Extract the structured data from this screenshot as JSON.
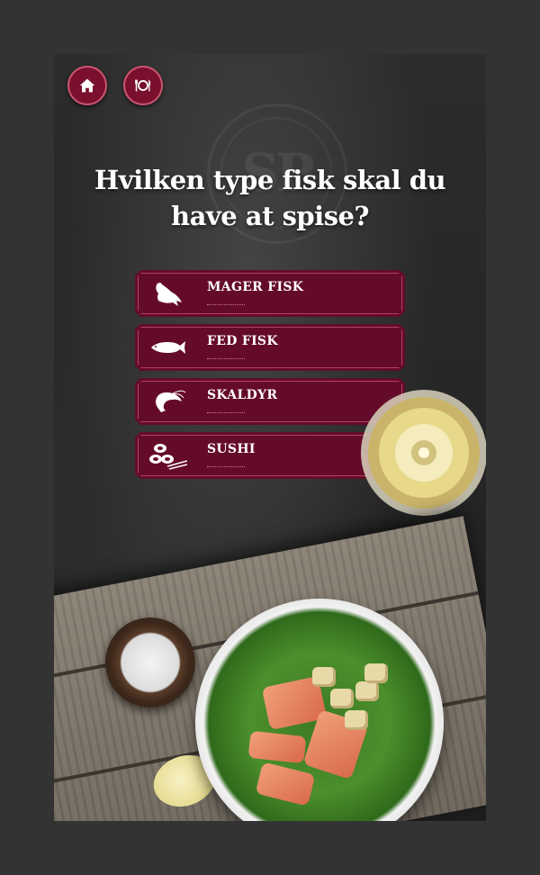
{
  "nav": {
    "home_icon": "home-icon",
    "menu_icon": "plate-cutlery-icon"
  },
  "question": {
    "line1": "Hvilken type fisk skal du",
    "line2": "have at spise?"
  },
  "options": [
    {
      "label": "MAGER FISK",
      "icon": "lean-fish-icon"
    },
    {
      "label": "FED FISK",
      "icon": "fatty-fish-icon"
    },
    {
      "label": "SKALDYR",
      "icon": "shrimp-icon"
    },
    {
      "label": "SUSHI",
      "icon": "sushi-icon"
    }
  ],
  "logo_text": "SP",
  "colors": {
    "accent": "#650b2a",
    "accent_border": "#b0405f",
    "button": "#7a0f2e",
    "background": "#333333"
  }
}
